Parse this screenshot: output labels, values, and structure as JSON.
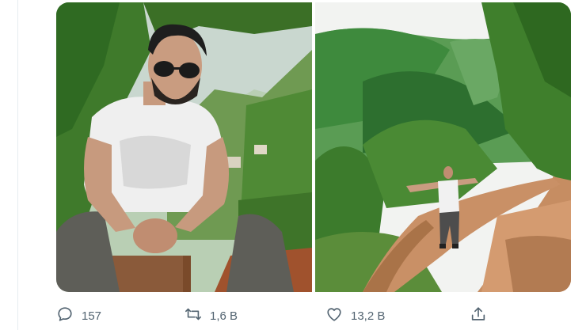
{
  "tweet": {
    "media": [
      {
        "icon": "photo-man-sitting-on-stool",
        "alt": ""
      },
      {
        "icon": "photo-man-arms-spread-on-mountain-path",
        "alt": ""
      }
    ],
    "actions": {
      "reply": {
        "icon": "reply-icon",
        "count": "157"
      },
      "retweet": {
        "icon": "retweet-icon",
        "count": "1,6 B"
      },
      "like": {
        "icon": "like-icon",
        "count": "13,2 B"
      },
      "share": {
        "icon": "share-icon"
      }
    },
    "colors": {
      "icon_gray": "#536471",
      "divider": "#e6ecf0"
    }
  }
}
